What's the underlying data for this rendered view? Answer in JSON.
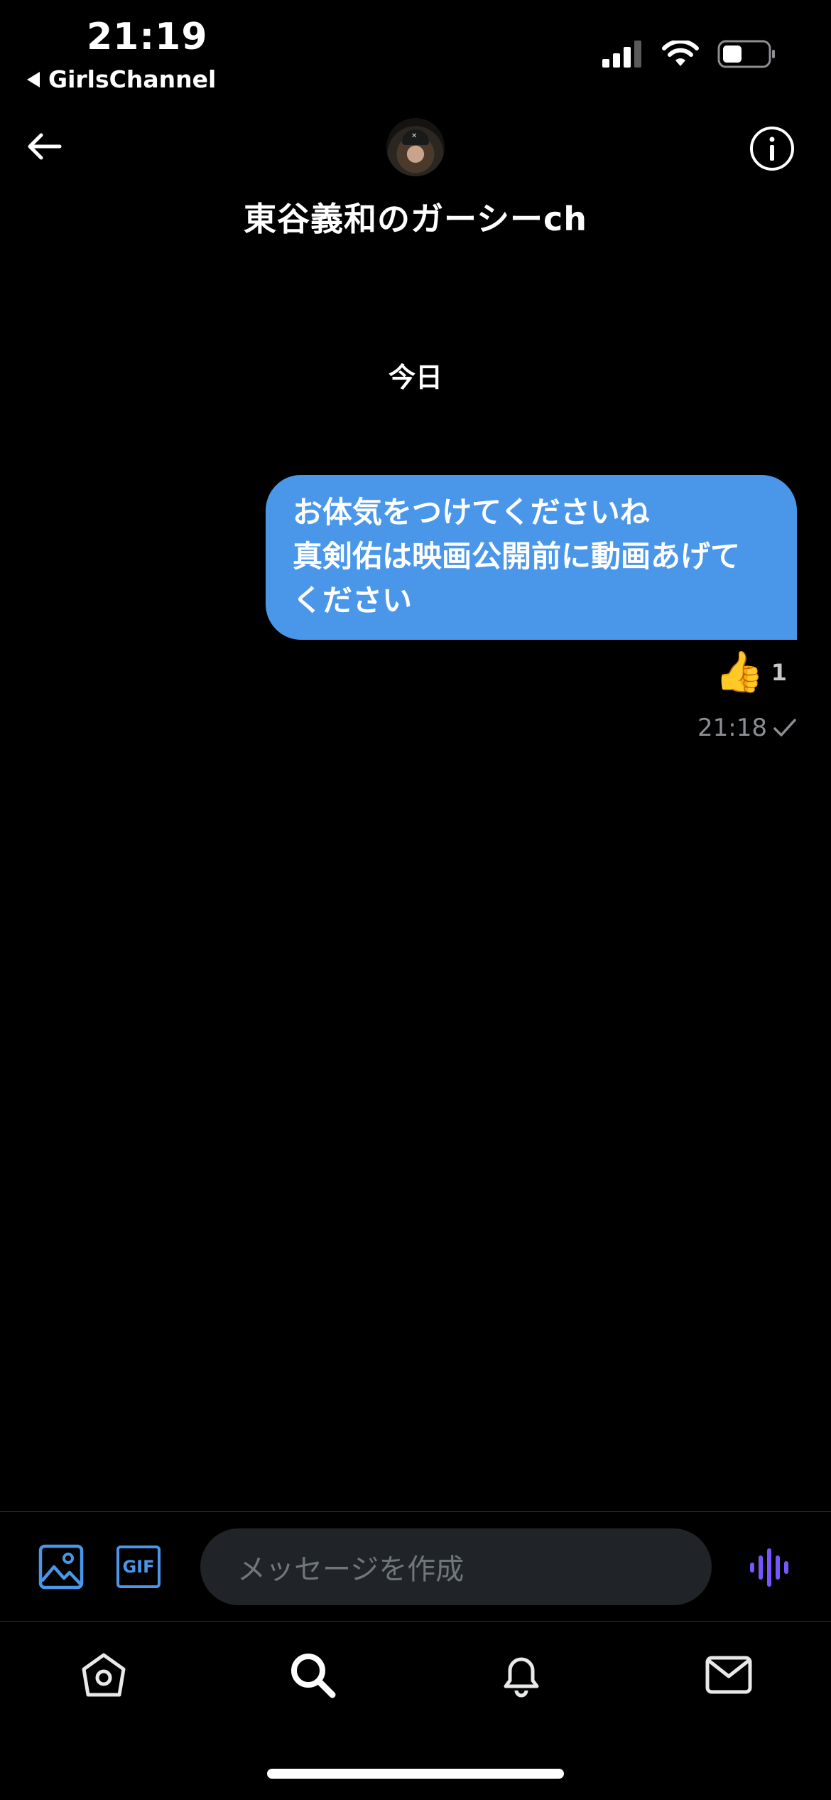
{
  "status_bar": {
    "time": "21:19",
    "back_app_label": "GirlsChannel",
    "icons": [
      "cellular-signal-icon",
      "wifi-icon",
      "battery-icon"
    ]
  },
  "header": {
    "title": "東谷義和のガーシーch",
    "back_icon": "back-arrow-icon",
    "info_icon": "info-icon"
  },
  "conversation": {
    "date_separator": "今日",
    "messages": [
      {
        "lines": [
          "お体気をつけてくださいね",
          "真剣佑は映画公開前に動画あげて",
          "ください"
        ],
        "reaction_emoji": "👍",
        "reaction_count": "1",
        "time": "21:18",
        "status_icon": "sent-check-icon"
      }
    ]
  },
  "composer": {
    "placeholder": "メッセージを作成",
    "gif_label": "GIF",
    "media_icon": "image-icon",
    "voice_icon": "voice-message-icon"
  },
  "tab_bar": {
    "tabs": [
      "home-icon",
      "search-icon",
      "notifications-icon",
      "messages-icon"
    ]
  },
  "colors": {
    "bubble": "#4a97ea",
    "accent_blue": "#1d9bf0",
    "voice_purple": "#7856ff",
    "input_bg": "#202327"
  }
}
